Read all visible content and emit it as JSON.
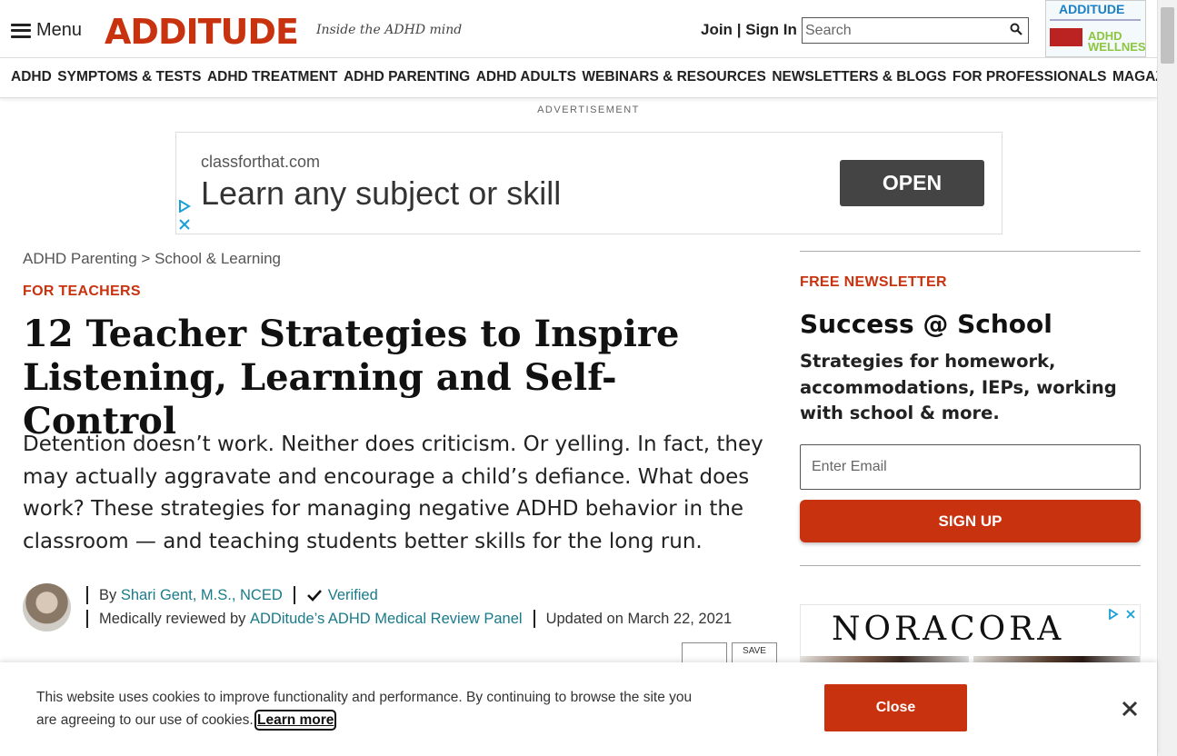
{
  "header": {
    "menu_label": "Menu",
    "logo_text": "ADDITUDE",
    "tagline": "Inside the ADHD mind",
    "join_label": "Join",
    "signin_label": "Sign In",
    "join_separator": "|",
    "search_placeholder": "Search",
    "magazine_thumb": {
      "title": "ADDITUDE",
      "subtitle": "ADHD WELLNESS"
    }
  },
  "nav": {
    "items": [
      {
        "label": "ADHD"
      },
      {
        "label": "SYMPTOMS & TESTS"
      },
      {
        "label": "ADHD TREATMENT"
      },
      {
        "label": "ADHD PARENTING"
      },
      {
        "label": "ADHD ADULTS"
      },
      {
        "label": "WEBINARS & RESOURCES"
      },
      {
        "label": "NEWSLETTERS & BLOGS"
      },
      {
        "label": "FOR PROFESSIONALS"
      },
      {
        "label": "MAGAZINE"
      }
    ]
  },
  "advertisement": {
    "label": "ADVERTISEMENT",
    "domain": "classforthat.com",
    "headline": "Learn any subject or skill",
    "cta": "OPEN"
  },
  "article": {
    "breadcrumb": {
      "parent": "ADHD Parenting",
      "separator": ">",
      "current": "School & Learning"
    },
    "kicker": "FOR TEACHERS",
    "title": "12 Teacher Strategies to Inspire Listening, Learning and Self-Control",
    "dek": "Detention doesn’t work. Neither does criticism. Or yelling. In fact, they may actually aggravate and encourage a child’s defiance. What does work? These strategies for managing negative ADHD behavior in the classroom — and teaching students better skills for the long run.",
    "byline": {
      "by_prefix": "By",
      "author": "Shari Gent, M.S., NCED",
      "verified_label": "Verified",
      "reviewed_prefix": "Medically reviewed by",
      "reviewer": "ADDitude’s ADHD Medical Review Panel",
      "updated": "Updated on March 22, 2021"
    },
    "save_label": "SAVE"
  },
  "sidebar": {
    "newsletter": {
      "kicker": "FREE NEWSLETTER",
      "title": "Success @ School",
      "description": "Strategies for homework, accommodations, IEPs, working with school & more.",
      "email_placeholder": "Enter Email",
      "signup_label": "SIGN UP"
    },
    "ad": {
      "brand": "NORACORA"
    }
  },
  "cookie_banner": {
    "text": "This website uses cookies to improve functionality and performance. By continuing to browse the site you are agreeing to our use of cookies.",
    "learn_more": "Learn more",
    "close_label": "Close"
  },
  "colors": {
    "brand_red": "#c8320f",
    "link_teal": "#1a7a8a",
    "ad_button": "#444444"
  },
  "icons": [
    "hamburger-icon",
    "search-icon",
    "ad-choices-icon",
    "ad-close-icon",
    "check-icon",
    "close-x-icon"
  ]
}
